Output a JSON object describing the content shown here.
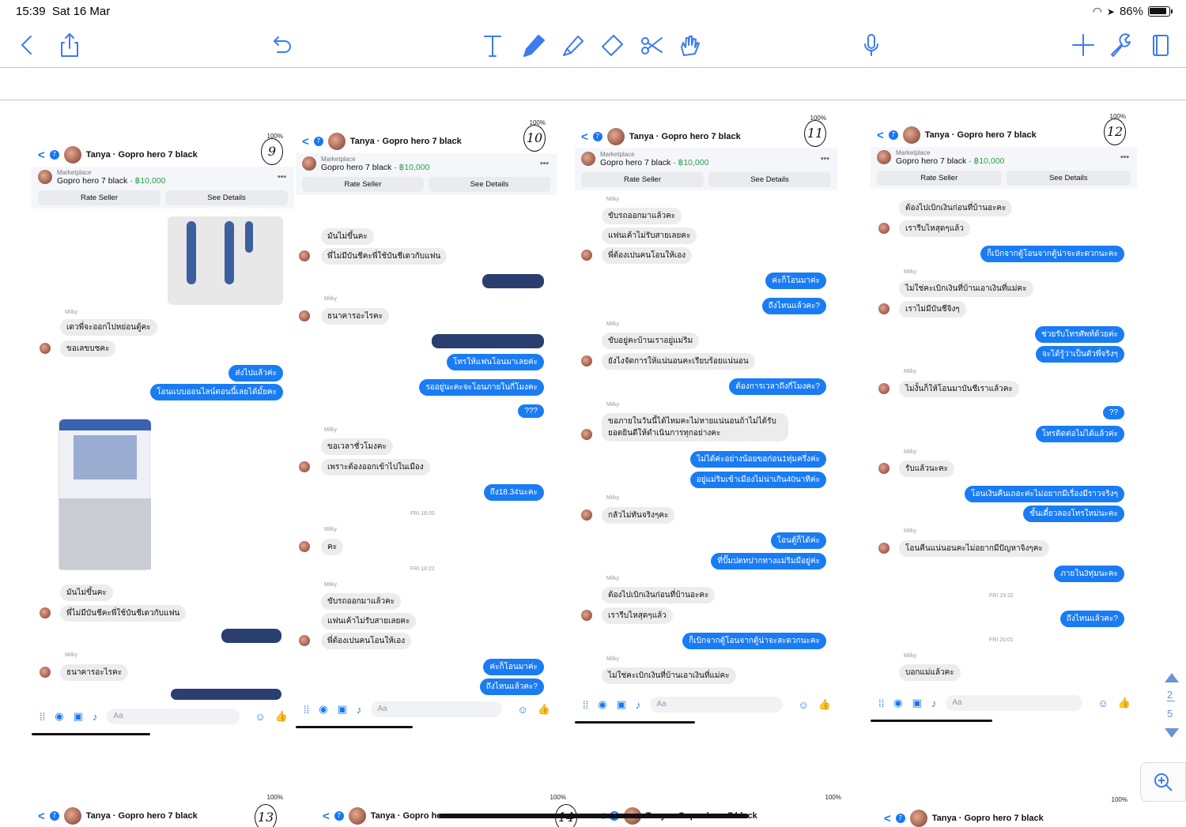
{
  "status_bar": {
    "time": "15:39",
    "date": "Sat 16 Mar",
    "battery": "86%"
  },
  "toolbar": {
    "left": [
      "back-icon",
      "share-icon",
      "undo-icon"
    ],
    "tools": [
      "text-tool-icon",
      "pen-tool-icon",
      "highlighter-icon",
      "eraser-icon",
      "scissors-icon",
      "hand-icon"
    ],
    "right": [
      "microphone-icon",
      "add-icon",
      "wrench-icon",
      "page-icon"
    ]
  },
  "common": {
    "thread_title": "Tanya · Gopro hero 7 black",
    "marketplace": "Marketplace",
    "item": "Gopro hero 7 black",
    "price": "฿10,000",
    "rate_seller": "Rate Seller",
    "see_details": "See Details",
    "input_placeholder": "Aa",
    "sender": "Milky",
    "battery_small": "100%"
  },
  "cards": [
    {
      "number": "9",
      "messages_in": [
        "เดวพี่จะออกไปหย่อนตู้คะ",
        "ขอเลขบชคะ",
        "มันไม่ขึ้นคะ",
        "พี่ไม่มีบันชีคะพี่ใช้บันชีเดวกับแฟน",
        "ธนาคารอะไรคะ"
      ],
      "messages_out": [
        "ส่งไปแล้วค่ะ",
        "โอนแบบออนไลน์ตอนนี้เลยได้มั้ยคะ"
      ]
    },
    {
      "number": "10",
      "messages_in": [
        "มันไม่ขึ้นคะ",
        "พี่ไม่มีบันชีคะพี่ใช้บันชีเดวกับแฟน",
        "ธนาคารอะไรคะ",
        "ขอเวลาชั่วโมงคะ",
        "เพราะต้องออกเข้าไปในเมือง",
        "คะ",
        "ขับรถออกมาแล้วคะ",
        "แฟนเค้าไม่รับสายเลยคะ",
        "พี่ต้องเปนคนโอนให้เอง"
      ],
      "messages_out": [
        "โทรให้แฟนโอนมาเลยค่ะ",
        "รออยู่นะคะจะโอนภายในกี่โมงคะ",
        "???",
        "ถึง18.34นะคะ",
        "ค่ะก็โอนมาค่ะ",
        "ถึงไหนแล้วคะ?"
      ],
      "timestamps": [
        "FRI 18:05",
        "FRI 18:22"
      ]
    },
    {
      "number": "11",
      "messages_in": [
        "ขับรถออกมาแล้วคะ",
        "แฟนเค้าไม่รับสายเลยคะ",
        "พี่ต้องเปนคนโอนให้เอง",
        "ขับอยู่คะบ้านเราอยู่แม่ริม",
        "ยังไงจัดการให้แน่นอนคะเรียบร้อยแน่นอน",
        "ขอภายในวันนี้ได้ไหมคะไม่หายแน่นอนถ้าไม่ได้รับ",
        "ยอดยินดีให้ดำเนินการทุกอย่างคะ",
        "กลัวไม่ทันจริงๆคะ",
        "ต้องไปเบิกเงินก่อนที่บ้านอะคะ",
        "เรารีบไหสุดๆแล้ว",
        "ไม่ใช่คะเบิกเงินที่บ้านเอาเงินที่แม่คะ"
      ],
      "messages_out": [
        "ค่ะก็โอนมาค่ะ",
        "ถึงไหนแล้วคะ?",
        "ต้องการเวลาถึงกี่โมงคะ?",
        "ไม่ได้ค่ะอย่างน้อยขอก่อน1ทุ่มครึ่งค่ะ",
        "อยู่แม่ริมเข้าเมืองไม่น่าเกิน40นาทีค่ะ",
        "โอนตู้ก็ได้ค่ะ",
        "ที่ปั๊มปตทปากทางแม่ริมมีอยู่ค่ะ",
        "ก็เบิกจากตู้โอนจากตู้น่าจะสะดวกนะคะ"
      ]
    },
    {
      "number": "12",
      "messages_in": [
        "ต้องไปเบิกเงินก่อนที่บ้านอะคะ",
        "เรารีบไหสุดๆแล้ว",
        "ไม่ใช่คะเบิกเงินที่บ้านเอาเงินที่แม่คะ",
        "เราไม่มีบันชีจิงๆ",
        "ไม่งั้นก็ให้โอนมาบันชีเราแล้วคะ",
        "รับแล้วนะคะ",
        "โอนคืนแน่นอนคะไม่อยากมีปัญหาจิงๆคะ",
        "บอกแม่แล้วคะ"
      ],
      "messages_out": [
        "ก็เบิกจากตู้โอนจากตู้น่าจะสะดวกนะคะ",
        "ช่วยรับโทรศัพท์ด้วยค่ะ",
        "จะได้รู้ว่าเป็นตัวพี่จริงๆ",
        "??",
        "โทรติดต่อไม่ได้แล้วค่ะ",
        "โอนเงินคืนเถอะค่ะไม่อยากมีเรื่องมีราวจริงๆ",
        "ขั้นเดี๋ยวลองโทรใหม่นะคะ",
        "ภายใน3ทุ่มนะคะ",
        "ถึงไหนแล้วคะ?"
      ],
      "timestamps": [
        "FRI 19:32",
        "FRI 20:01"
      ]
    }
  ],
  "bottom_cards": [
    {
      "number": "13",
      "title": "Tanya · Gopro hero 7 black"
    },
    {
      "number": "14",
      "title": "Tanya · Gopro he"
    },
    {
      "number": "",
      "title": "Tanya · Gopro hero 7 black"
    }
  ],
  "page_nav": {
    "current": "2",
    "total": "5"
  }
}
